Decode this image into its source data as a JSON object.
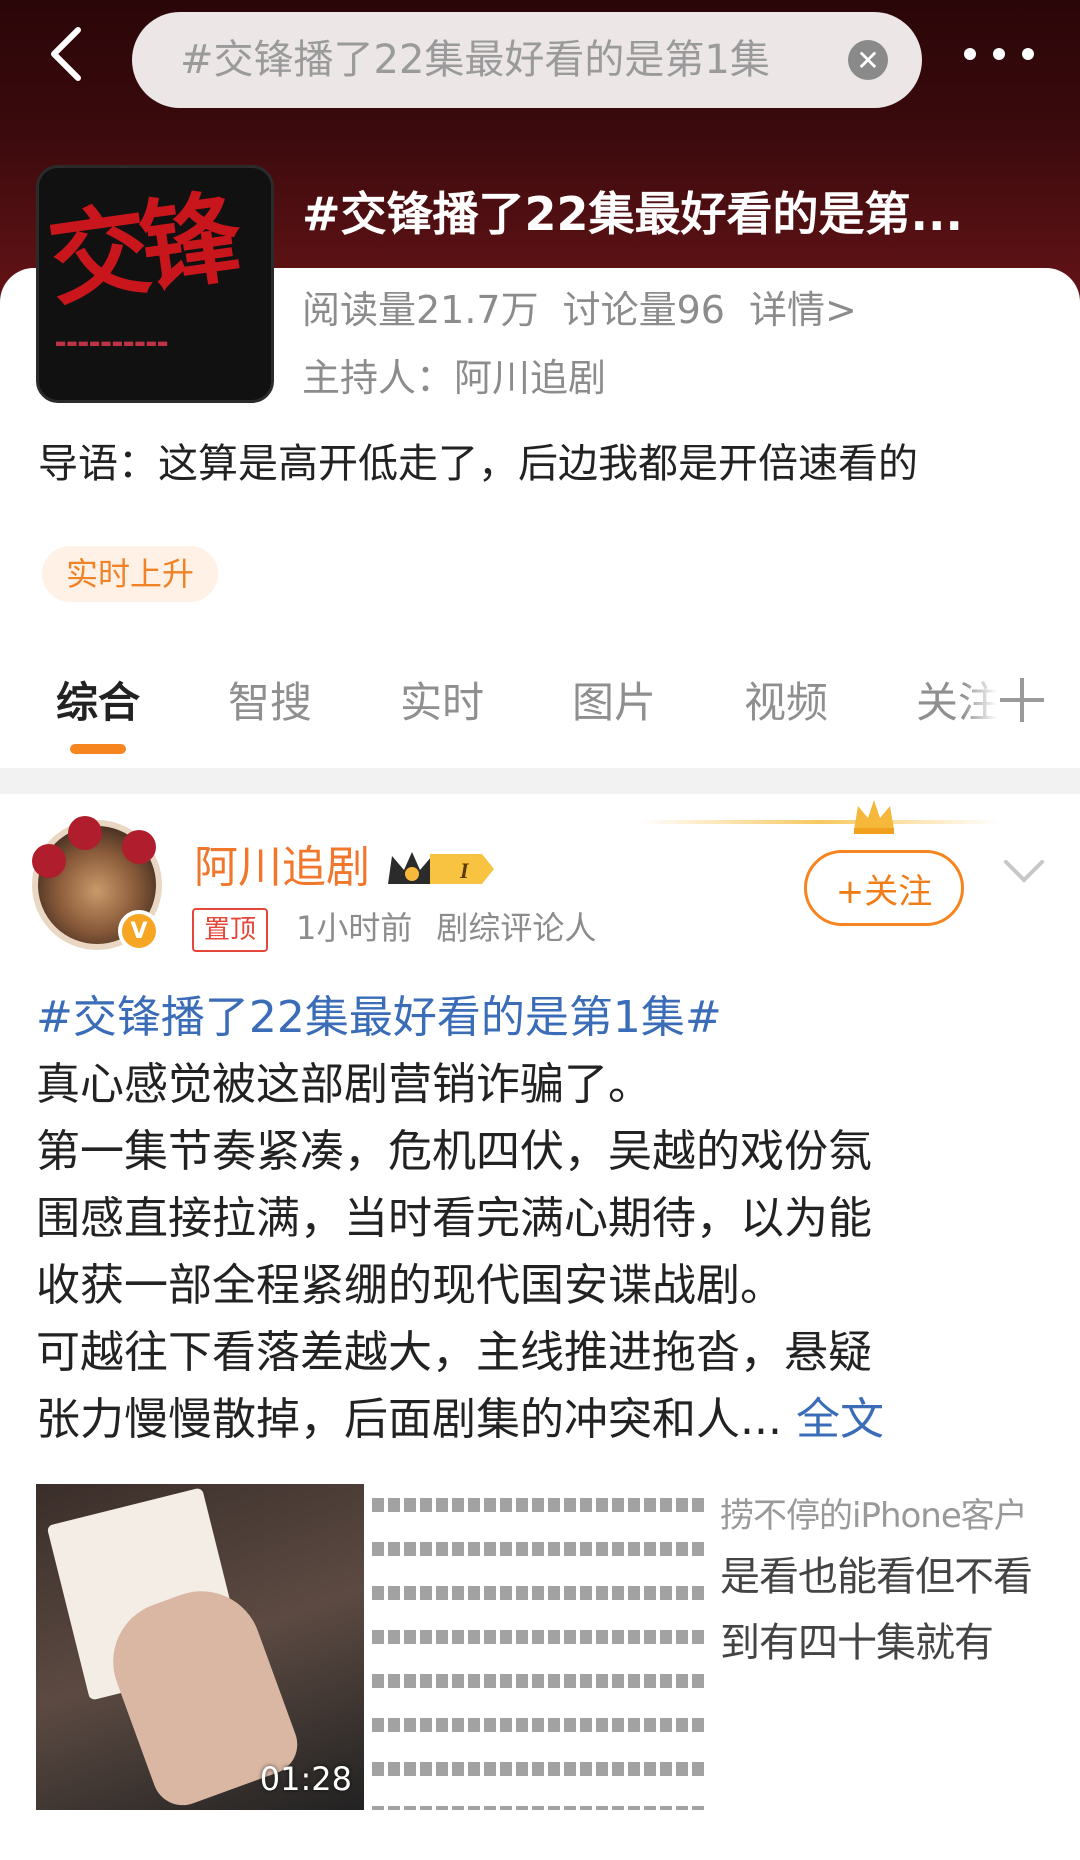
{
  "search": {
    "query": "#交锋播了22集最好看的是第1集"
  },
  "topic": {
    "title": "#交锋播了22集最好看的是第...",
    "cover_title": "交锋",
    "reads": "阅读量21.7万",
    "discussions": "讨论量96",
    "details_link": "详情>",
    "host": "主持人：阿川追剧",
    "intro": "导语：这算是高开低走了，后边我都是开倍速看的",
    "trend_tag": "实时上升"
  },
  "tabs": [
    "综合",
    "智搜",
    "实时",
    "图片",
    "视频",
    "关注"
  ],
  "post": {
    "user_name": "阿川追剧",
    "level": "I",
    "pin_tag": "置顶",
    "time": "1小时前",
    "role": "剧综评论人",
    "follow_label": "+关注",
    "hashtag": "#交锋播了22集最好看的是第1集#",
    "lines": [
      "真心感觉被这部剧营销诈骗了。",
      "第一集节奏紧凑，危机四伏，吴越的戏份氛",
      "围感直接拉满，当时看完满心期待，以为能",
      "收获一部全程紧绷的现代国安谍战剧。",
      "可越往下看落差越大，主线推进拖沓，悬疑",
      "张力慢慢散掉，后面剧集的冲突和人..."
    ],
    "fulltext_label": "全文",
    "video_duration": "01:28",
    "image3_lines": [
      "捞不停的iPhone客户",
      "是看也能看但不看",
      "到有四十集就有"
    ]
  },
  "colors": {
    "accent": "#f7851f",
    "link": "#3a6cb8",
    "username": "#f0772c",
    "pin": "#e4473a"
  }
}
